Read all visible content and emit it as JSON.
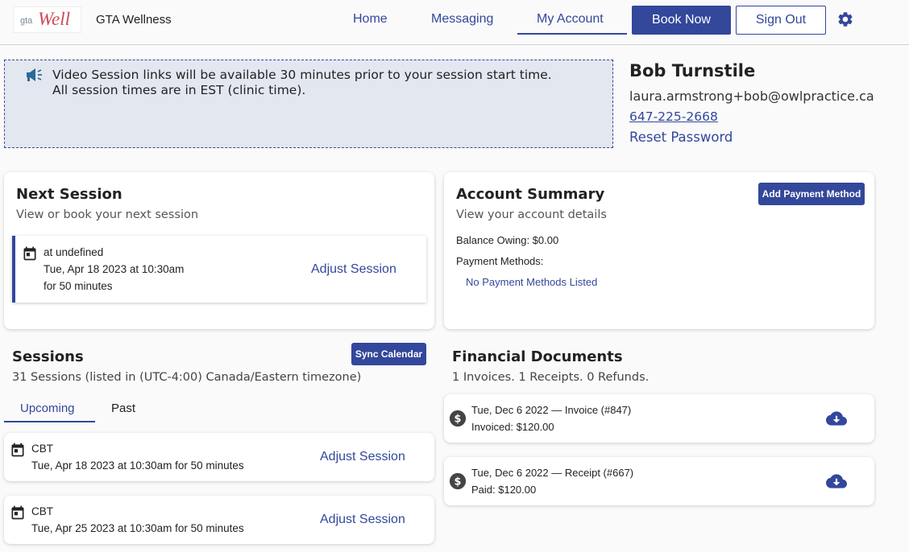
{
  "app": {
    "logo": {
      "prefix": "gta",
      "script": "Well"
    },
    "brand": "GTA Wellness"
  },
  "nav": {
    "home": "Home",
    "messaging": "Messaging",
    "my_account": "My Account",
    "book_now": "Book Now",
    "sign_out": "Sign Out",
    "active": "My Account"
  },
  "notice": {
    "line1": "Video Session links will be available 30 minutes prior to your session start time.",
    "line2": "All session times are in EST (clinic time)."
  },
  "profile": {
    "name": "Bob Turnstile",
    "email": "laura.armstrong+bob@owlpractice.ca",
    "phone": "647-225-2668",
    "reset": "Reset Password"
  },
  "next_session": {
    "title": "Next Session",
    "subtitle": "View or book your next session",
    "location": "at undefined",
    "datetime": "Tue, Apr 18 2023 at 10:30am",
    "duration": "for 50 minutes",
    "action": "Adjust Session"
  },
  "account_summary": {
    "title": "Account Summary",
    "subtitle": "View your account details",
    "add_payment": "Add Payment Method",
    "balance": "Balance Owing: $0.00",
    "payment_methods_label": "Payment Methods:",
    "payment_methods_empty": "No Payment Methods Listed"
  },
  "sessions": {
    "title": "Sessions",
    "sync": "Sync Calendar",
    "count": "31 Sessions (listed in (UTC-4:00) Canada/Eastern timezone)",
    "tabs": [
      "Upcoming",
      "Past"
    ],
    "active_tab": "Upcoming",
    "items": [
      {
        "type": "CBT",
        "when": "Tue, Apr 18 2023 at 10:30am for 50 minutes",
        "action": "Adjust Session"
      },
      {
        "type": "CBT",
        "when": "Tue, Apr 25 2023 at 10:30am for 50 minutes",
        "action": "Adjust Session"
      }
    ]
  },
  "financial": {
    "title": "Financial Documents",
    "summary": "1 Invoices. 1 Receipts. 0 Refunds.",
    "items": [
      {
        "heading": "Tue, Dec 6 2022 — Invoice (#847)",
        "amount": "Invoiced: $120.00"
      },
      {
        "heading": "Tue, Dec 6 2022 — Receipt (#667)",
        "amount": "Paid: $120.00"
      }
    ]
  },
  "colors": {
    "primary": "#33479b",
    "notice_bg": "#e3e7f0",
    "logo_red": "#c94a55"
  },
  "icons": [
    "megaphone-icon",
    "gear-icon",
    "calendar-icon",
    "dollar-circle-icon",
    "cloud-download-icon"
  ]
}
